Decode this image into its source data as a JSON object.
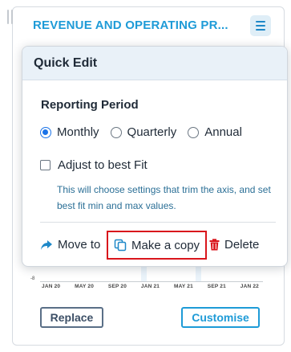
{
  "card": {
    "title": "REVENUE AND OPERATING PR...",
    "menu_icon": "hamburger-menu-icon"
  },
  "chart": {
    "y_tick": "-8",
    "x_ticks": [
      "JAN 20",
      "MAY 20",
      "SEP 20",
      "JAN 21",
      "MAY 21",
      "SEP 21",
      "JAN 22"
    ]
  },
  "buttons": {
    "replace": "Replace",
    "customise": "Customise"
  },
  "popup": {
    "title": "Quick Edit",
    "reporting_period_label": "Reporting Period",
    "options": [
      {
        "label": "Monthly",
        "selected": true
      },
      {
        "label": "Quarterly",
        "selected": false
      },
      {
        "label": "Annual",
        "selected": false
      }
    ],
    "adjust_label": "Adjust to best Fit",
    "adjust_checked": false,
    "help_text": "This will choose settings that trim the axis, and set best fit min and max values.",
    "actions": {
      "move": "Move to",
      "copy": "Make a copy",
      "delete": "Delete"
    }
  },
  "colors": {
    "accent": "#1e9bd7",
    "radio": "#1a73e8",
    "delete": "#d9161c",
    "highlight_border": "#d9161c"
  }
}
